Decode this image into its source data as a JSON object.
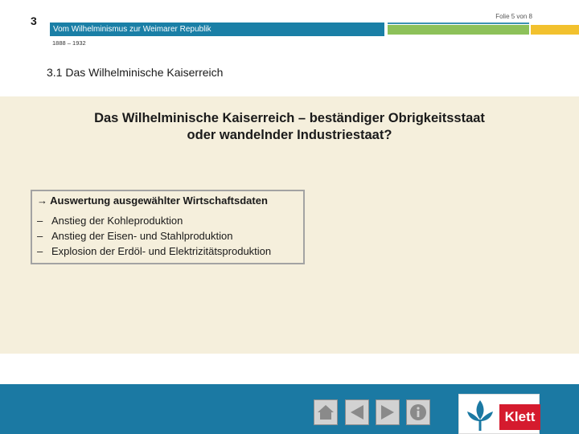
{
  "header": {
    "chapter_number": "3",
    "series_title": "Vom Wilhelminismus zur Weimarer Republik",
    "slide_counter": "Folie 5 von 8",
    "date_range": "1888 – 1932"
  },
  "section": {
    "title": "3.1  Das Wilhelminische Kaiserreich"
  },
  "main": {
    "question_line1": "Das Wilhelminische Kaiserreich – beständiger Obrigkeitsstaat",
    "question_line2": "oder wandelnder Industriestaat?"
  },
  "info_box": {
    "title": "→ Auswertung ausgewählter Wirtschaftsdaten",
    "items": [
      {
        "dash": "–",
        "text": "Anstieg der Kohleproduktion"
      },
      {
        "dash": "–",
        "text": "Anstieg der Eisen- und Stahlproduktion"
      },
      {
        "dash": "–",
        "text": "Explosion der Erdöl- und Elektrizitätsproduktion"
      }
    ]
  },
  "footer": {
    "buttons": [
      {
        "icon": "home-icon"
      },
      {
        "icon": "arrow-left-icon"
      },
      {
        "icon": "arrow-right-icon"
      },
      {
        "icon": "info-icon"
      }
    ],
    "logo_text": "Klett"
  },
  "colors": {
    "header_blue": "#1a7fa6",
    "header_green": "#8dc15a",
    "header_yellow": "#f2c12e",
    "panel_beige": "#f5efdc",
    "footer_blue": "#1b79a3",
    "logo_red": "#d51b2e"
  }
}
